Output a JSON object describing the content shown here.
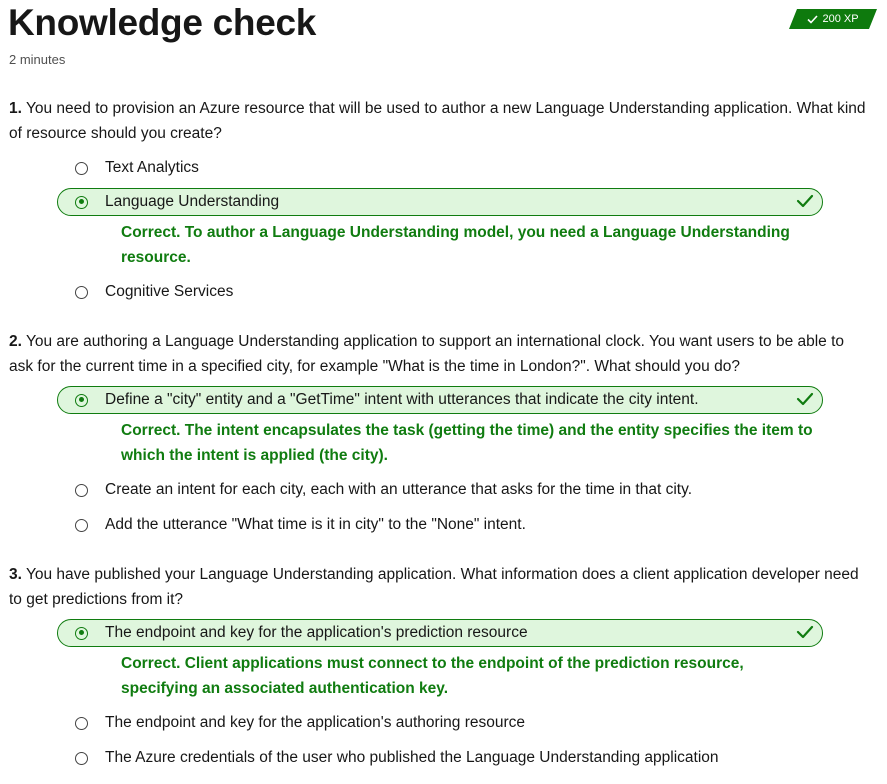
{
  "header": {
    "title": "Knowledge check",
    "duration": "2 minutes",
    "xp": "200 XP",
    "accent": "#107c10"
  },
  "questions": [
    {
      "number": "1.",
      "text": " You need to provision an Azure resource that will be used to author a new Language Understanding application. What kind of resource should you create?",
      "options": [
        {
          "label": "Text Analytics",
          "selected": false
        },
        {
          "label": "Language Understanding",
          "selected": true,
          "correct": true
        },
        {
          "label": "Cognitive Services",
          "selected": false
        }
      ],
      "feedback": "Correct. To author a Language Understanding model, you need a Language Understanding resource."
    },
    {
      "number": "2.",
      "text": " You are authoring a Language Understanding application to support an international clock. You want users to be able to ask for the current time in a specified city, for example \"What is the time in London?\". What should you do?",
      "options": [
        {
          "label": "Define a \"city\" entity and a \"GetTime\" intent with utterances that indicate the city intent.",
          "selected": true,
          "correct": true
        },
        {
          "label": "Create an intent for each city, each with an utterance that asks for the time in that city.",
          "selected": false
        },
        {
          "label": "Add the utterance \"What time is it in city\" to the \"None\" intent.",
          "selected": false
        }
      ],
      "feedback": "Correct. The intent encapsulates the task (getting the time) and the entity specifies the item to which the intent is applied (the city)."
    },
    {
      "number": "3.",
      "text": " You have published your Language Understanding application. What information does a client application developer need to get predictions from it?",
      "options": [
        {
          "label": "The endpoint and key for the application's prediction resource",
          "selected": true,
          "correct": true
        },
        {
          "label": "The endpoint and key for the application's authoring resource",
          "selected": false
        },
        {
          "label": "The Azure credentials of the user who published the Language Understanding application",
          "selected": false
        }
      ],
      "feedback": "Correct. Client applications must connect to the endpoint of the prediction resource, specifying an associated authentication key."
    }
  ]
}
